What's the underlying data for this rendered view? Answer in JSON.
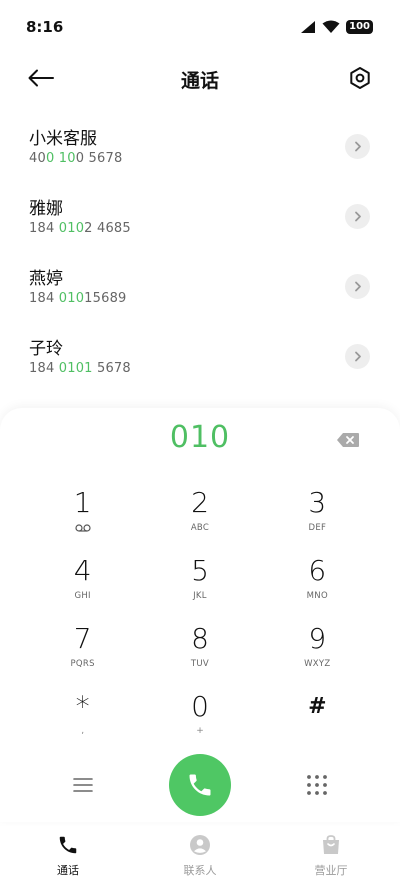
{
  "status_bar": {
    "time": "8:16",
    "battery": "100"
  },
  "header": {
    "title": "通话"
  },
  "contacts": [
    {
      "name": "小米客服",
      "number_parts": [
        "40",
        "0",
        " ",
        "10",
        "0 5678"
      ]
    },
    {
      "name": "雅娜",
      "number_parts": [
        "184 ",
        "010",
        "2 4685"
      ]
    },
    {
      "name": "燕婷",
      "number_parts": [
        "184 ",
        "010",
        "15689"
      ]
    },
    {
      "name": "子玲",
      "number_parts": [
        "184 ",
        "0101",
        " 5678"
      ]
    }
  ],
  "dialer": {
    "input": "010",
    "keys": [
      {
        "digit": "1",
        "letters": ""
      },
      {
        "digit": "2",
        "letters": "ABC"
      },
      {
        "digit": "3",
        "letters": "DEF"
      },
      {
        "digit": "4",
        "letters": "GHI"
      },
      {
        "digit": "5",
        "letters": "JKL"
      },
      {
        "digit": "6",
        "letters": "MNO"
      },
      {
        "digit": "7",
        "letters": "PQRS"
      },
      {
        "digit": "8",
        "letters": "TUV"
      },
      {
        "digit": "9",
        "letters": "WXYZ"
      },
      {
        "digit": "*",
        "letters": ","
      },
      {
        "digit": "0",
        "letters": "+"
      },
      {
        "digit": "#",
        "letters": ""
      }
    ]
  },
  "bottom_nav": [
    {
      "label": "通话",
      "icon": "phone-icon",
      "active": true
    },
    {
      "label": "联系人",
      "icon": "contacts-icon",
      "active": false
    },
    {
      "label": "营业厅",
      "icon": "shopping-bag-icon",
      "active": false
    }
  ],
  "colors": {
    "accent": "#4fbf63",
    "call_button": "#4fc764"
  }
}
